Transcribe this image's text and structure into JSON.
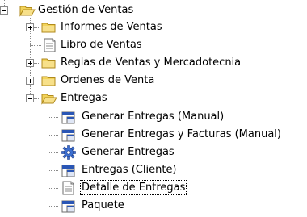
{
  "tree": {
    "root": {
      "label": "Gestión de Ventas",
      "icon": "folder-open-icon",
      "expanded": true
    },
    "children": [
      {
        "label": "Informes de Ventas",
        "icon": "folder-icon",
        "expanded": false
      },
      {
        "label": "Libro de Ventas",
        "icon": "report-icon"
      },
      {
        "label": "Reglas de Ventas y Mercadotecnia",
        "icon": "folder-icon",
        "expanded": false
      },
      {
        "label": "Ordenes de Venta",
        "icon": "folder-icon",
        "expanded": false
      },
      {
        "label": "Entregas",
        "icon": "folder-open-icon",
        "expanded": true,
        "children": [
          {
            "label": "Generar Entregas (Manual)",
            "icon": "window-icon"
          },
          {
            "label": "Generar Entregas y Facturas (Manual)",
            "icon": "window-icon"
          },
          {
            "label": "Generar Entregas",
            "icon": "process-gear-icon"
          },
          {
            "label": "Entregas (Cliente)",
            "icon": "window-icon"
          },
          {
            "label": "Detalle de Entregas",
            "icon": "report-icon",
            "selected": true
          },
          {
            "label": "Paquete",
            "icon": "window-icon"
          }
        ]
      }
    ]
  },
  "colors": {
    "folder": "#f2d35a",
    "folder_outline": "#b08a1c",
    "window_bar": "#2a56b5",
    "gear": "#3c6fd1",
    "guide_line": "#8a8a8a"
  }
}
